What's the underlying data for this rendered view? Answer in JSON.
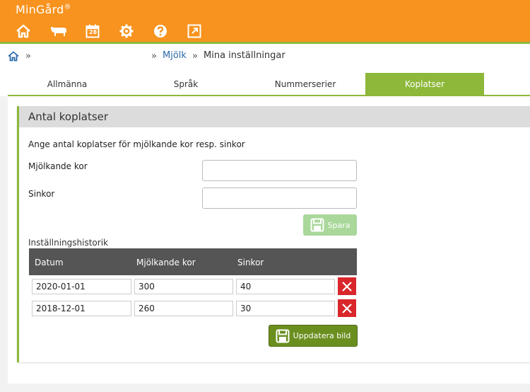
{
  "header": {
    "brand": "MinGård",
    "brand_mark": "®",
    "icons": [
      "home-icon",
      "cow-icon",
      "calendar-icon",
      "gear-icon",
      "help-icon",
      "external-link-icon"
    ],
    "calendar_day": "28",
    "colors": {
      "bar": "#f7931e",
      "accent": "#8db83a"
    }
  },
  "breadcrumb": {
    "sep": "»",
    "link": "Mjölk",
    "current": "Mina inställningar"
  },
  "tabs": [
    {
      "label": "Allmänna",
      "active": false
    },
    {
      "label": "Språk",
      "active": false
    },
    {
      "label": "Nummerserier",
      "active": false
    },
    {
      "label": "Koplatser",
      "active": true
    }
  ],
  "panel": {
    "title": "Antal koplatser",
    "instruction": "Ange antal koplatser för mjölkande kor resp. sinkor",
    "milking_label": "Mjölkande kor",
    "milking_value": "",
    "dry_label": "Sinkor",
    "dry_value": "",
    "save_label": "Spara",
    "history_label": "Inställningshistorik",
    "columns": [
      "Datum",
      "Mjölkande kor",
      "Sinkor"
    ],
    "rows": [
      {
        "date": "2020-01-01",
        "milking": "300",
        "dry": "40"
      },
      {
        "date": "2018-12-01",
        "milking": "260",
        "dry": "30"
      }
    ],
    "update_label": "Uppdatera bild"
  }
}
